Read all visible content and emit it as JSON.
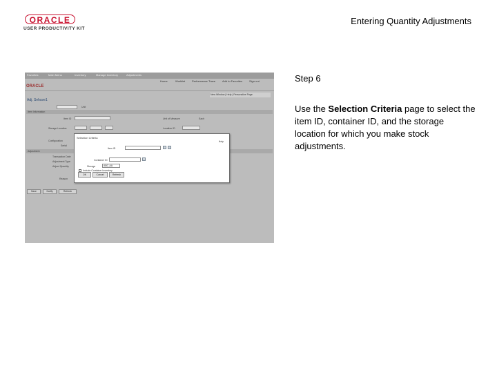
{
  "header": {
    "logo_text": "ORACLE",
    "logo_subtext": "USER PRODUCTIVITY KIT",
    "document_title": "Entering Quantity Adjustments"
  },
  "screenshot": {
    "brand": "ORACLE",
    "page_title": "Adj. Sehuve1",
    "modal": {
      "title": "Selection Criteria",
      "help_link": "Help",
      "label_item": "Item ID",
      "label_container": "Container ID",
      "label_storage": "Storage",
      "storage_value": "ABC-AA",
      "checkbox_label": "Include Container Inventory",
      "ok_button": "OK",
      "cancel_button": "Cancel",
      "refresh_button": "Refresh"
    }
  },
  "instructions": {
    "step": "Step 6",
    "text_before": "Use the ",
    "text_bold": "Selection Criteria",
    "text_after": " page to select the item ID, container ID, and the storage location for which you make stock adjustments."
  }
}
